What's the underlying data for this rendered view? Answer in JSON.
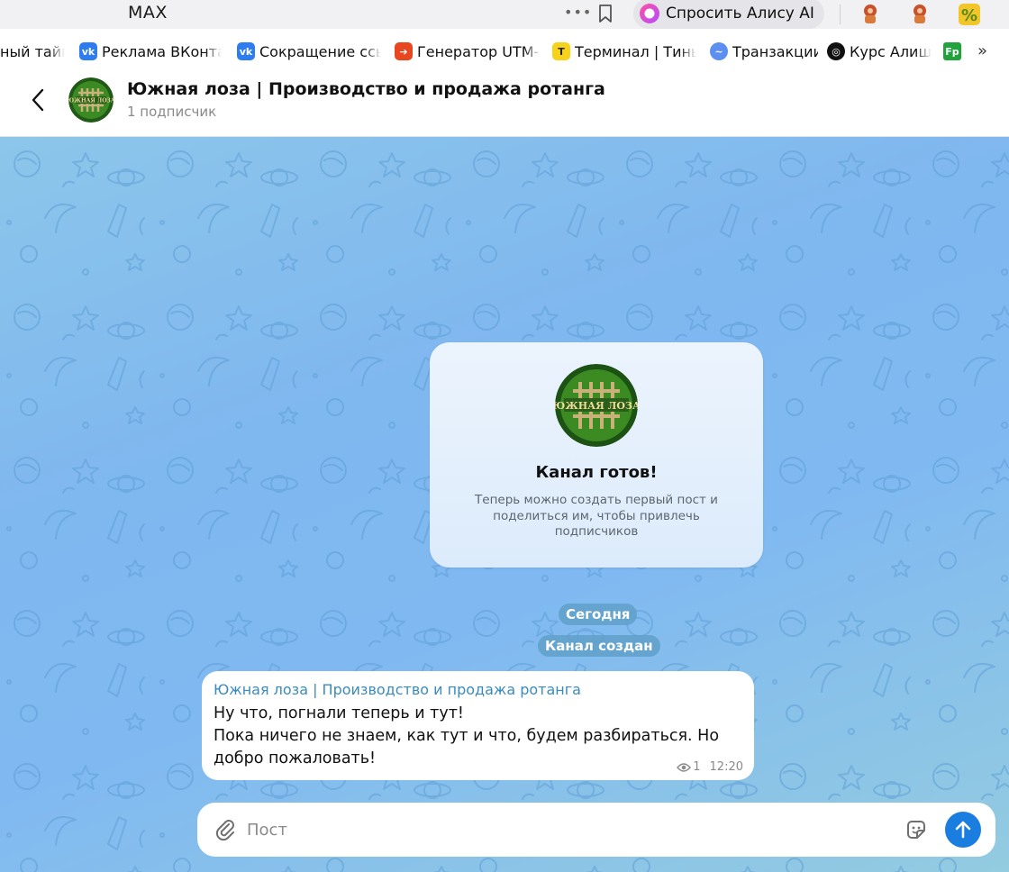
{
  "browser": {
    "tab_title": "MAX",
    "alice_button": "Спросить Алису AI",
    "icons": [
      "more-dots-icon",
      "bookmark-icon",
      "alice-icon",
      "extension-icon",
      "percent-extension-icon"
    ]
  },
  "bookmarks": {
    "items": [
      {
        "label": "ный тайм",
        "icon": "none"
      },
      {
        "label": "Реклама ВКонтакте",
        "icon": "vk-icon"
      },
      {
        "label": "Сокращение ссылок",
        "icon": "vk-icon"
      },
      {
        "label": "Генератор UTM-меток",
        "icon": "arrow-icon"
      },
      {
        "label": "Терминал | Тинькофф",
        "icon": "tinkoff-icon"
      },
      {
        "label": "Транзакции",
        "icon": "chart-icon"
      },
      {
        "label": "Курс Алишер",
        "icon": "target-icon"
      },
      {
        "label": "Fp",
        "icon": "fp-icon"
      }
    ],
    "more": "»"
  },
  "channel": {
    "title": "Южная лоза | Производство и продажа ротанга",
    "subscribers": "1 подписчик",
    "logo_text": "ЮЖНАЯ ЛОЗА"
  },
  "ready_card": {
    "title": "Канал готов!",
    "text": "Теперь можно создать первый пост и поделиться им, чтобы привлечь подписчиков"
  },
  "service": {
    "date": "Сегодня",
    "created": "Канал создан"
  },
  "message": {
    "author": "Южная лоза | Производство и продажа ротанга",
    "lines": [
      "Ну что, погнали теперь и тут!",
      "Пока ничего не знаем, как тут и что, будем разбираться. Но добро пожаловать!"
    ],
    "views": "1",
    "time": "12:20"
  },
  "composer": {
    "placeholder": "Пост"
  },
  "colors": {
    "accent": "#1a7de0",
    "author": "#3a8bbd",
    "chat_bg": "#80b9f1",
    "logo_green": "#2f6e1e"
  }
}
